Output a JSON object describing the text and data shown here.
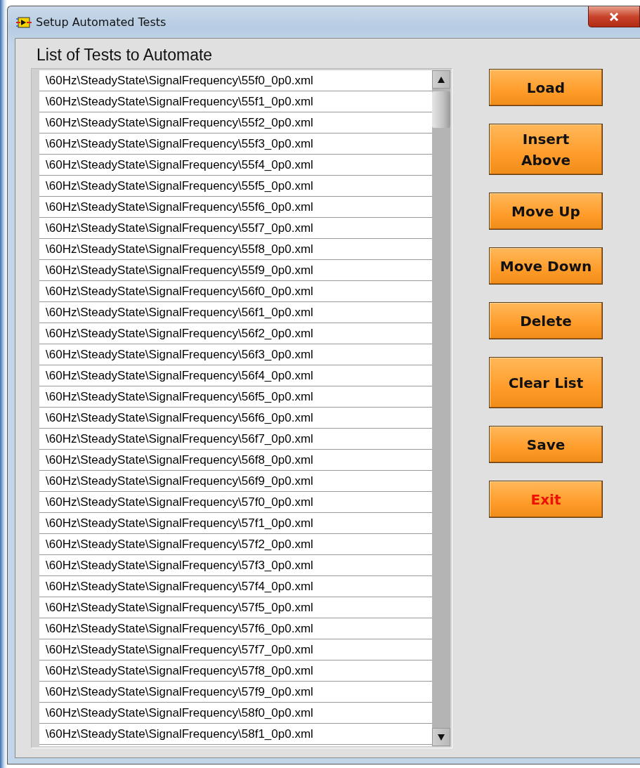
{
  "window": {
    "title": "Setup Automated Tests"
  },
  "list": {
    "label": "List of Tests to Automate",
    "items": [
      "\\60Hz\\SteadyState\\SignalFrequency\\55f0_0p0.xml",
      "\\60Hz\\SteadyState\\SignalFrequency\\55f1_0p0.xml",
      "\\60Hz\\SteadyState\\SignalFrequency\\55f2_0p0.xml",
      "\\60Hz\\SteadyState\\SignalFrequency\\55f3_0p0.xml",
      "\\60Hz\\SteadyState\\SignalFrequency\\55f4_0p0.xml",
      "\\60Hz\\SteadyState\\SignalFrequency\\55f5_0p0.xml",
      "\\60Hz\\SteadyState\\SignalFrequency\\55f6_0p0.xml",
      "\\60Hz\\SteadyState\\SignalFrequency\\55f7_0p0.xml",
      "\\60Hz\\SteadyState\\SignalFrequency\\55f8_0p0.xml",
      "\\60Hz\\SteadyState\\SignalFrequency\\55f9_0p0.xml",
      "\\60Hz\\SteadyState\\SignalFrequency\\56f0_0p0.xml",
      "\\60Hz\\SteadyState\\SignalFrequency\\56f1_0p0.xml",
      "\\60Hz\\SteadyState\\SignalFrequency\\56f2_0p0.xml",
      "\\60Hz\\SteadyState\\SignalFrequency\\56f3_0p0.xml",
      "\\60Hz\\SteadyState\\SignalFrequency\\56f4_0p0.xml",
      "\\60Hz\\SteadyState\\SignalFrequency\\56f5_0p0.xml",
      "\\60Hz\\SteadyState\\SignalFrequency\\56f6_0p0.xml",
      "\\60Hz\\SteadyState\\SignalFrequency\\56f7_0p0.xml",
      "\\60Hz\\SteadyState\\SignalFrequency\\56f8_0p0.xml",
      "\\60Hz\\SteadyState\\SignalFrequency\\56f9_0p0.xml",
      "\\60Hz\\SteadyState\\SignalFrequency\\57f0_0p0.xml",
      "\\60Hz\\SteadyState\\SignalFrequency\\57f1_0p0.xml",
      "\\60Hz\\SteadyState\\SignalFrequency\\57f2_0p0.xml",
      "\\60Hz\\SteadyState\\SignalFrequency\\57f3_0p0.xml",
      "\\60Hz\\SteadyState\\SignalFrequency\\57f4_0p0.xml",
      "\\60Hz\\SteadyState\\SignalFrequency\\57f5_0p0.xml",
      "\\60Hz\\SteadyState\\SignalFrequency\\57f6_0p0.xml",
      "\\60Hz\\SteadyState\\SignalFrequency\\57f7_0p0.xml",
      "\\60Hz\\SteadyState\\SignalFrequency\\57f8_0p0.xml",
      "\\60Hz\\SteadyState\\SignalFrequency\\57f9_0p0.xml",
      "\\60Hz\\SteadyState\\SignalFrequency\\58f0_0p0.xml",
      "\\60Hz\\SteadyState\\SignalFrequency\\58f1_0p0.xml"
    ]
  },
  "buttons": [
    {
      "label": "Load",
      "kind": "normal"
    },
    {
      "label": "Insert Above",
      "kind": "normal"
    },
    {
      "label": "Move Up",
      "kind": "normal"
    },
    {
      "label": "Move Down",
      "kind": "normal"
    },
    {
      "label": "Delete",
      "kind": "normal"
    },
    {
      "label": "Clear List",
      "kind": "normal"
    },
    {
      "label": "Save",
      "kind": "normal"
    },
    {
      "label": "Exit",
      "kind": "danger"
    }
  ]
}
